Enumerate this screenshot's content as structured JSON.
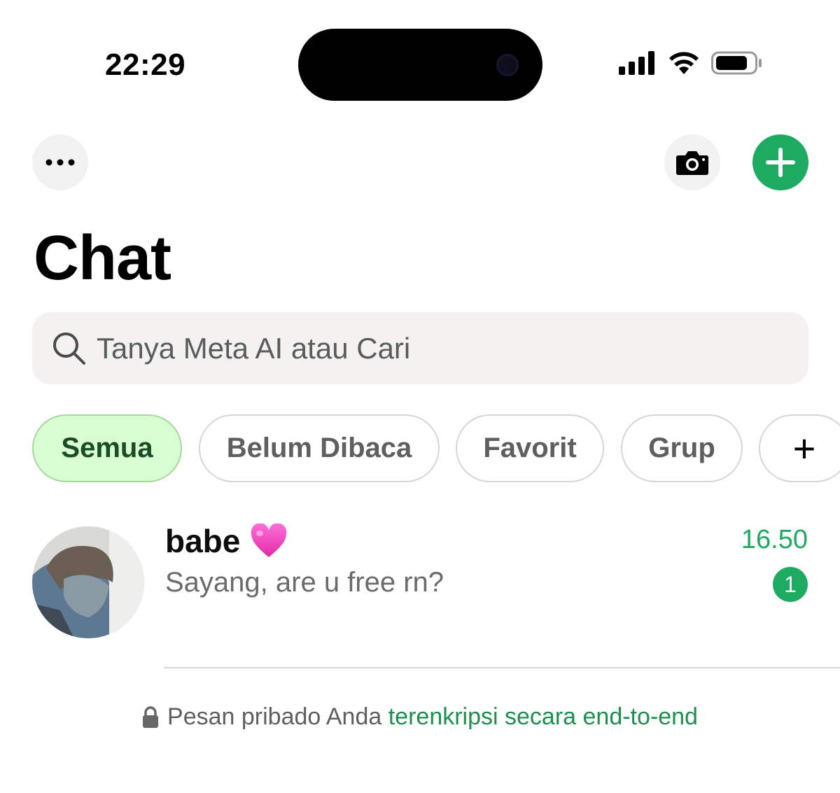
{
  "status_bar": {
    "time": "22:29",
    "icons": [
      "cellular-signal-icon",
      "wifi-icon",
      "battery-icon"
    ]
  },
  "header": {
    "more_icon": "ellipsis-icon",
    "camera_icon": "camera-icon",
    "new_chat_icon": "plus-icon",
    "title": "Chat"
  },
  "search": {
    "placeholder": "Tanya Meta AI atau Cari",
    "value": ""
  },
  "filters": [
    {
      "label": "Semua",
      "active": true
    },
    {
      "label": "Belum Dibaca",
      "active": false
    },
    {
      "label": "Favorit",
      "active": false
    },
    {
      "label": "Grup",
      "active": false
    },
    {
      "label": "+",
      "active": false
    }
  ],
  "chats": [
    {
      "name": "babe",
      "emoji": "💗",
      "preview": "Sayang, are u free rn?",
      "time": "16.50",
      "unread": "1"
    }
  ],
  "footer": {
    "lock_icon": "lock-icon",
    "text_prefix": "Pesan pribado Anda",
    "text_link": "terenkripsi secara end-to-end"
  },
  "colors": {
    "accent": "#1daa61",
    "chip_active_bg": "#d9fdd3",
    "link": "#1d8f4e"
  }
}
